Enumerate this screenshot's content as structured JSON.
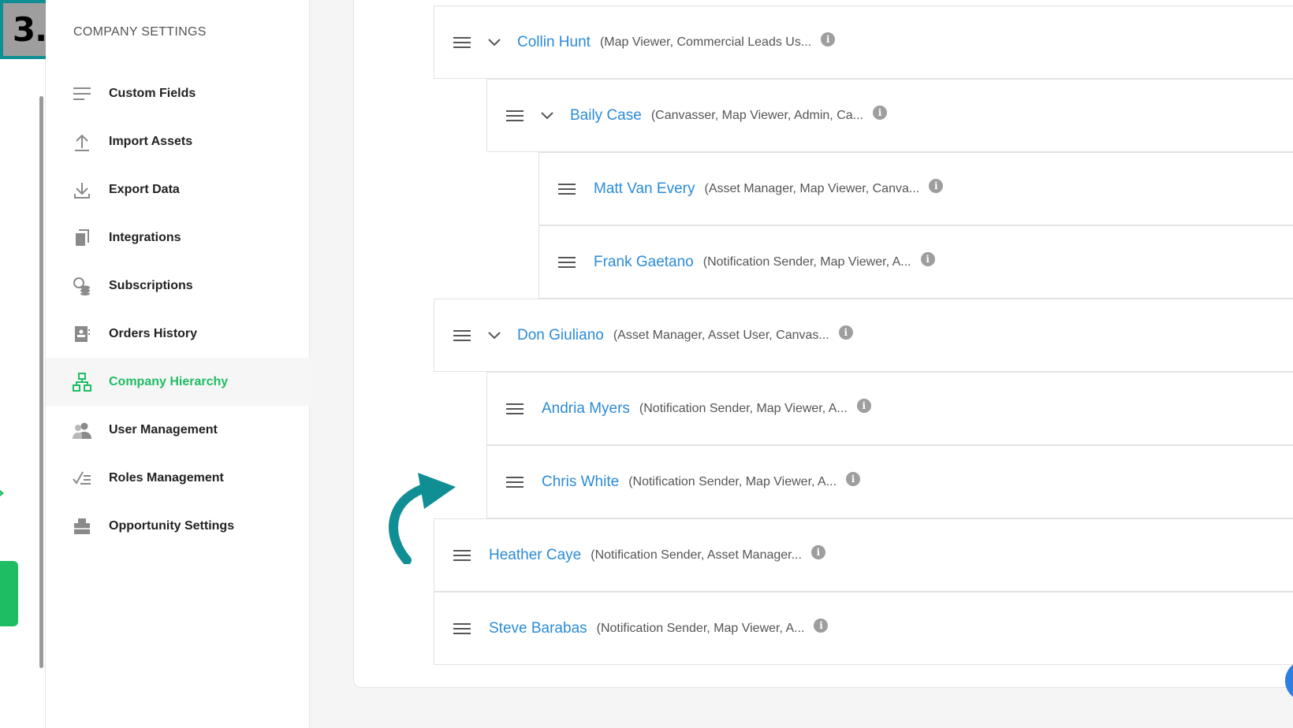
{
  "step_badge": "3.",
  "sidebar": {
    "title": "COMPANY SETTINGS",
    "items": [
      {
        "label": "Custom Fields",
        "icon": "list-lines-icon",
        "active": false
      },
      {
        "label": "Import Assets",
        "icon": "upload-icon",
        "active": false
      },
      {
        "label": "Export Data",
        "icon": "download-icon",
        "active": false
      },
      {
        "label": "Integrations",
        "icon": "pages-icon",
        "active": false
      },
      {
        "label": "Subscriptions",
        "icon": "coins-icon",
        "active": false
      },
      {
        "label": "Orders History",
        "icon": "receipt-icon",
        "active": false
      },
      {
        "label": "Company Hierarchy",
        "icon": "hierarchy-icon",
        "active": true
      },
      {
        "label": "User Management",
        "icon": "users-icon",
        "active": false
      },
      {
        "label": "Roles Management",
        "icon": "checklist-icon",
        "active": false
      },
      {
        "label": "Opportunity Settings",
        "icon": "briefcase-icon",
        "active": false
      }
    ]
  },
  "hierarchy": [
    {
      "name": "Collin Hunt",
      "roles": "(Map Viewer, Commercial Leads Us...",
      "level": 0,
      "expandable": true
    },
    {
      "name": "Baily Case",
      "roles": "(Canvasser, Map Viewer, Admin, Ca...",
      "level": 1,
      "expandable": true
    },
    {
      "name": "Matt Van Every",
      "roles": "(Asset Manager, Map Viewer, Canva...",
      "level": 2,
      "expandable": false
    },
    {
      "name": "Frank Gaetano",
      "roles": "(Notification Sender, Map Viewer, A...",
      "level": 2,
      "expandable": false
    },
    {
      "name": "Don Giuliano",
      "roles": "(Asset Manager, Asset User, Canvas...",
      "level": 0,
      "expandable": true
    },
    {
      "name": "Andria Myers",
      "roles": "(Notification Sender, Map Viewer, A...",
      "level": 1,
      "expandable": false
    },
    {
      "name": "Chris White",
      "roles": "(Notification Sender, Map Viewer, A...",
      "level": 1,
      "expandable": false
    },
    {
      "name": "Heather Caye",
      "roles": "(Notification Sender, Asset Manager...",
      "level": 0,
      "expandable": false
    },
    {
      "name": "Steve Barabas",
      "roles": "(Notification Sender, Map Viewer, A...",
      "level": 0,
      "expandable": false
    }
  ],
  "colors": {
    "accent_green": "#1ebd63",
    "name_blue": "#2b8bd8",
    "annotation_teal": "#0f8f94"
  }
}
